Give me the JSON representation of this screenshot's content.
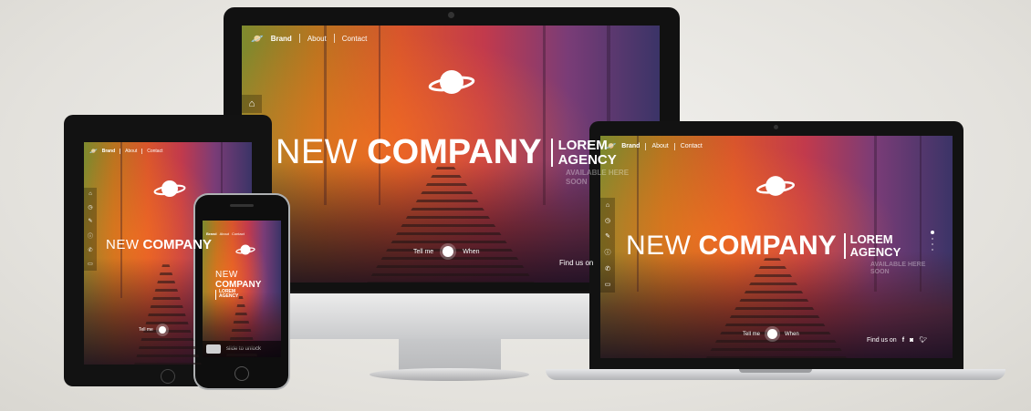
{
  "site": {
    "brand": "Brand",
    "nav": [
      "About",
      "Contact"
    ],
    "headline_light": "NEW",
    "headline_bold": "COMPANY",
    "agency_line1": "LOREM",
    "agency_line2": "AGENCY",
    "available_line1": "AVAILABLE HERE",
    "available_line2": "SOON",
    "toggle_left": "Tell me",
    "toggle_right": "When",
    "find_us": "Find us on"
  },
  "phone": {
    "unlock_text": "slide to unlock"
  },
  "icons": {
    "sidebar": [
      "home-icon",
      "clock-icon",
      "edit-icon",
      "info-icon",
      "phone-icon",
      "chat-icon"
    ],
    "social": [
      "facebook-icon",
      "instagram-icon",
      "twitter-icon"
    ]
  },
  "colors": {
    "device_black": "#121212",
    "silver": "#c9cacc",
    "accent_orange": "#e0572b",
    "accent_purple": "#5a3a77"
  }
}
